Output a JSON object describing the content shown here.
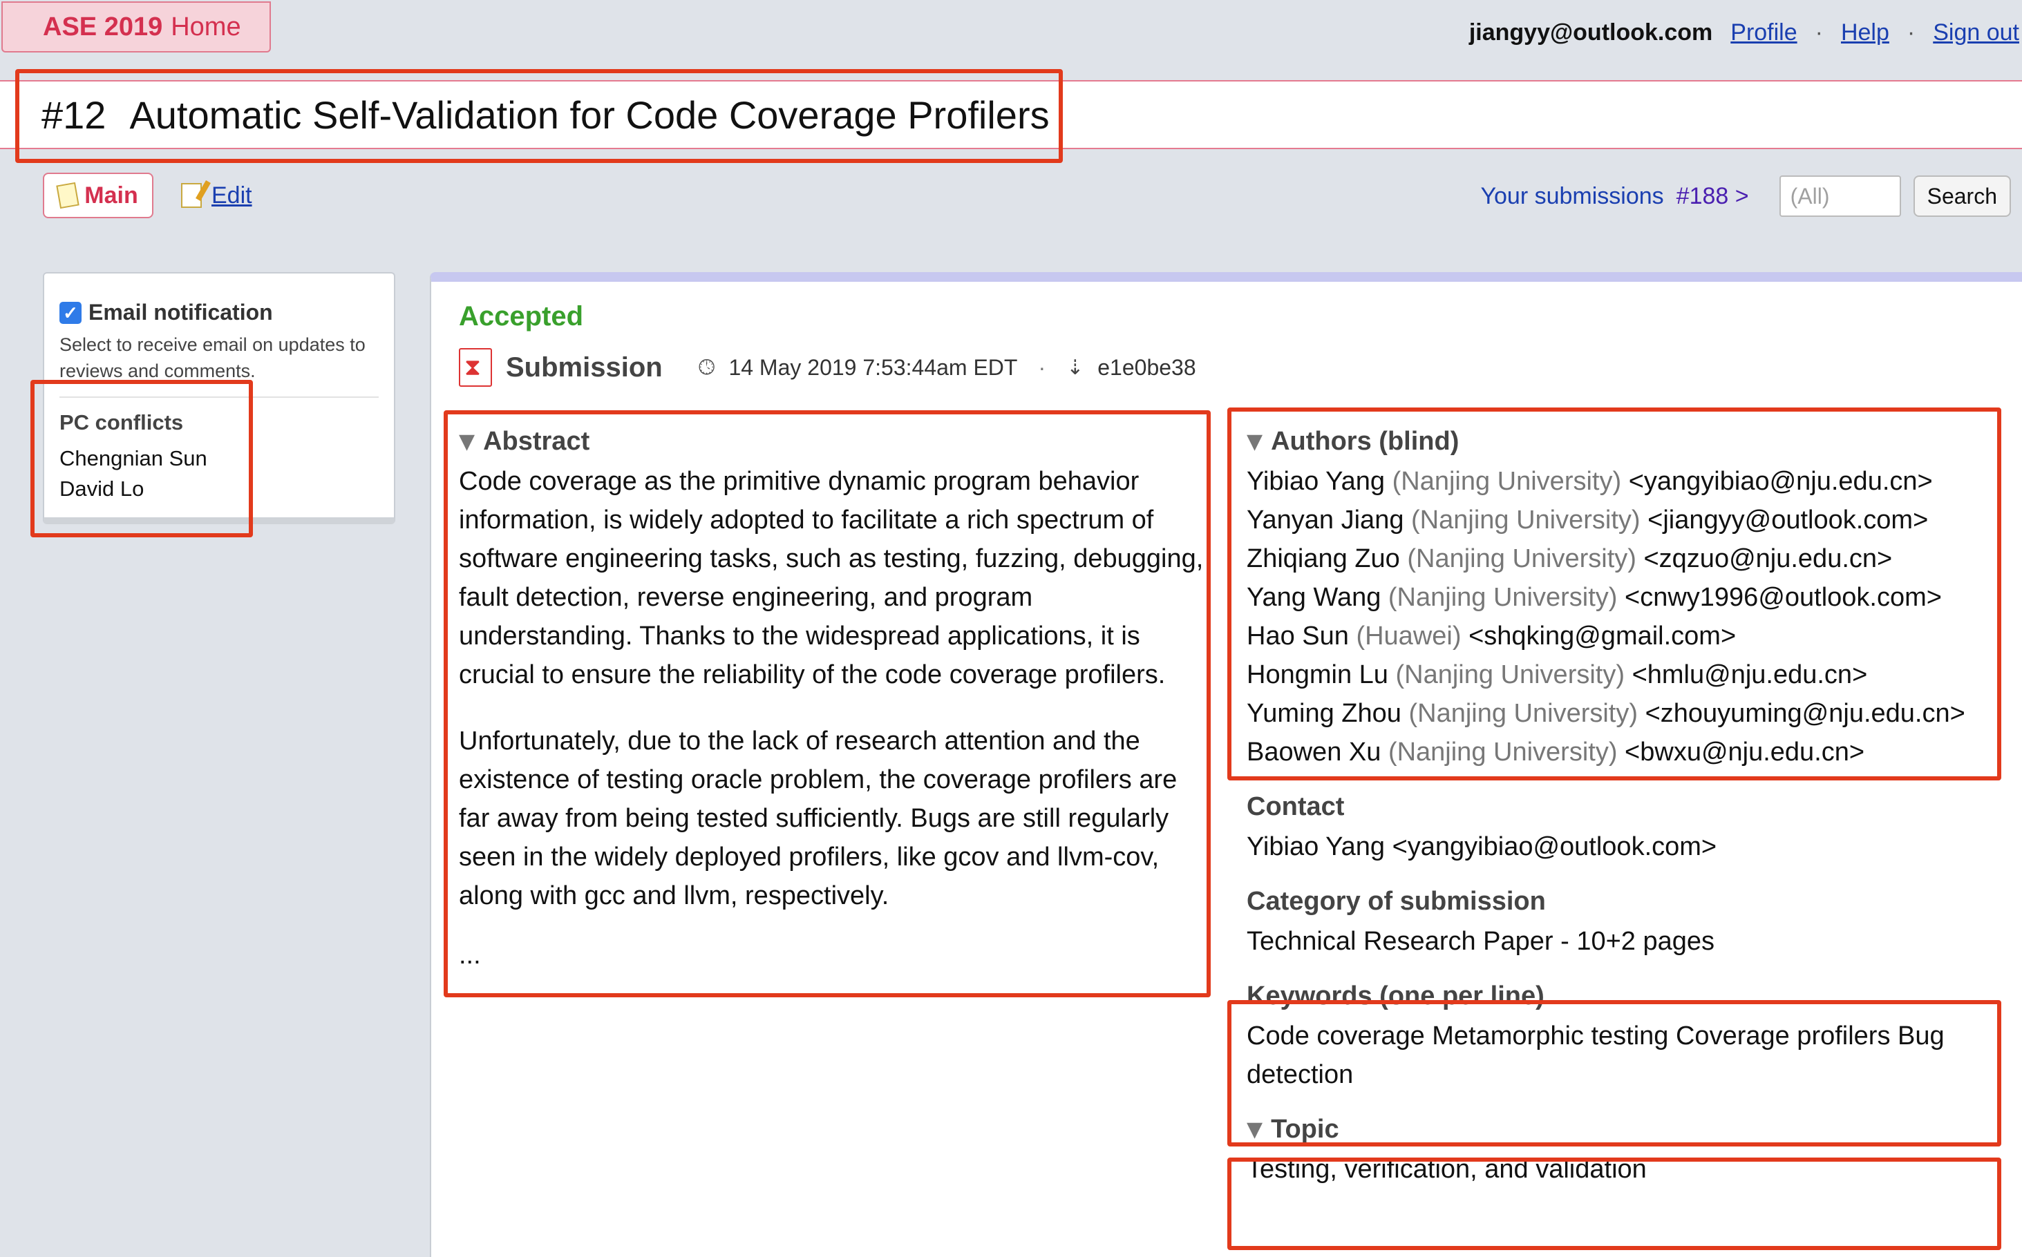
{
  "header": {
    "site_name": "ASE 2019",
    "site_home": "Home",
    "user_email": "jiangyy@outlook.com",
    "profile_label": "Profile",
    "help_label": "Help",
    "signout_label": "Sign out",
    "separator": "·"
  },
  "paper": {
    "number": "#12",
    "title": "Automatic Self-Validation for Code Coverage Profilers"
  },
  "tabs": {
    "main_label": "Main",
    "edit_label": "Edit"
  },
  "subnav": {
    "your_submissions": "Your submissions",
    "next_submission": "#188",
    "next_arrow": ">",
    "search_placeholder": "(All)",
    "search_button": "Search"
  },
  "sidebar": {
    "email_notification_label": "Email notification",
    "email_notification_checked": true,
    "email_help": "Select to receive email on updates to reviews and comments.",
    "pc_conflicts_title": "PC conflicts",
    "pc_conflicts": [
      "Chengnian Sun",
      "David Lo"
    ]
  },
  "submission": {
    "status": "Accepted",
    "label": "Submission",
    "timestamp": "14 May 2019 7:53:44am EDT",
    "hash": "e1e0be38"
  },
  "abstract": {
    "title": "Abstract",
    "paragraphs": [
      "Code coverage as the primitive dynamic program behavior information, is widely adopted to facilitate a rich spectrum of software engineering tasks, such as testing, fuzzing, debugging, fault detection, reverse engineering, and program understanding. Thanks to the widespread applications, it is crucial to ensure the reliability of the code coverage profilers.",
      "Unfortunately, due to the lack of research attention and the existence of testing oracle problem, the coverage profilers are far away from being tested sufficiently. Bugs are still regularly seen in the widely deployed profilers, like gcov and llvm-cov, along with gcc and llvm, respectively."
    ],
    "ellipsis": "..."
  },
  "authors": {
    "title": "Authors (blind)",
    "list": [
      {
        "name": "Yibiao Yang",
        "affiliation": "(Nanjing University)",
        "email": "<yangyibiao@nju.edu.cn>"
      },
      {
        "name": "Yanyan Jiang",
        "affiliation": "(Nanjing University)",
        "email": "<jiangyy@outlook.com>"
      },
      {
        "name": "Zhiqiang Zuo",
        "affiliation": "(Nanjing University)",
        "email": "<zqzuo@nju.edu.cn>"
      },
      {
        "name": "Yang Wang",
        "affiliation": "(Nanjing University)",
        "email": "<cnwy1996@outlook.com>"
      },
      {
        "name": "Hao Sun",
        "affiliation": "(Huawei)",
        "email": "<shqking@gmail.com>"
      },
      {
        "name": "Hongmin Lu",
        "affiliation": "(Nanjing University)",
        "email": "<hmlu@nju.edu.cn>"
      },
      {
        "name": "Yuming Zhou",
        "affiliation": "(Nanjing University)",
        "email": "<zhouyuming@nju.edu.cn>"
      },
      {
        "name": "Baowen Xu",
        "affiliation": "(Nanjing University)",
        "email": "<bwxu@nju.edu.cn>"
      }
    ]
  },
  "contact": {
    "title": "Contact",
    "value": "Yibiao Yang <yangyibiao@outlook.com>"
  },
  "category": {
    "title": "Category of submission",
    "value": "Technical Research Paper - 10+2 pages"
  },
  "keywords": {
    "title": "Keywords (one per line)",
    "value": "Code coverage Metamorphic testing Coverage profilers Bug detection"
  },
  "topic": {
    "title": "Topic",
    "value": "Testing, verification, and validation"
  },
  "colors": {
    "accent_pink": "#d4304f",
    "accepted_green": "#39a02c",
    "link_blue": "#1a3fb0",
    "annotation_red": "#e23a1c"
  }
}
